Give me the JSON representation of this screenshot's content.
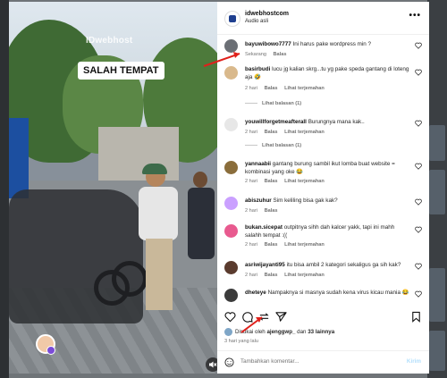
{
  "video": {
    "watermark": "IDwebhost",
    "overlay_label": "SALAH TEMPAT"
  },
  "post_header": {
    "username": "idwebhostcom",
    "audio": "Audio asli"
  },
  "comments": [
    {
      "user": "bayuwibowo7777",
      "text": "Ini harus pake wordpress min ?",
      "time": "Sekarang",
      "reply": "Balas",
      "translate": "",
      "avatar_color": "#6b6f75"
    },
    {
      "user": "basirbudi",
      "text": "lucu jg kalian skrg...tu yg pake speda gantang di loteng aja 🤣",
      "time": "2 hari",
      "reply": "Balas",
      "translate": "Lihat terjemahan",
      "avatar_color": "#d9b98c",
      "replies": "Lihat balasan (1)"
    },
    {
      "user": "youwillforgetmeafterall",
      "text": "Burungnya mana kak..",
      "time": "2 hari",
      "reply": "Balas",
      "translate": "Lihat terjemahan",
      "avatar_color": "#e7e7e7",
      "replies": "Lihat balasan (1)"
    },
    {
      "user": "yannaabii",
      "text": "gantang burung sambil ikut lomba buat website = kombinasi yang oke 😂",
      "time": "2 hari",
      "reply": "Balas",
      "translate": "Lihat terjemahan",
      "avatar_color": "#8a6d3b"
    },
    {
      "user": "abiszuhur",
      "text": "Sim keliling bisa gak kak?",
      "time": "2 hari",
      "reply": "Balas",
      "translate": "",
      "avatar_color": "#caa0ff"
    },
    {
      "user": "bukan.sicepat",
      "text": "outpitnya sihh dah kalcer yakk, tapi ini mahh salahh tempat :((",
      "time": "2 hari",
      "reply": "Balas",
      "translate": "Lihat terjemahan",
      "avatar_color": "#e85a8f"
    },
    {
      "user": "asriwijayanti95",
      "text": "itu bisa ambil 2 kategori sekaligus ga sih kak?",
      "time": "2 hari",
      "reply": "Balas",
      "translate": "Lihat terjemahan",
      "avatar_color": "#5a3b2e"
    },
    {
      "user": "dheteye",
      "text": "Nampaknya si masnya sudah kena virus kicau mania 😂",
      "time": "",
      "reply": "",
      "translate": "",
      "avatar_color": "#3b3b3b"
    }
  ],
  "likes": {
    "prefix": "Disukai oleh",
    "user": "ajenggwp_",
    "conj": "dan",
    "others": "33 lainnya"
  },
  "posted_time": "3 hari yang lalu",
  "add_comment": {
    "placeholder": "Tambahkan komentar...",
    "post_label": "Kirim"
  },
  "icons": [
    "more-icon",
    "heart-icon",
    "comment-icon",
    "share-icon",
    "bookmark-icon",
    "emoji-icon",
    "mute-icon"
  ]
}
